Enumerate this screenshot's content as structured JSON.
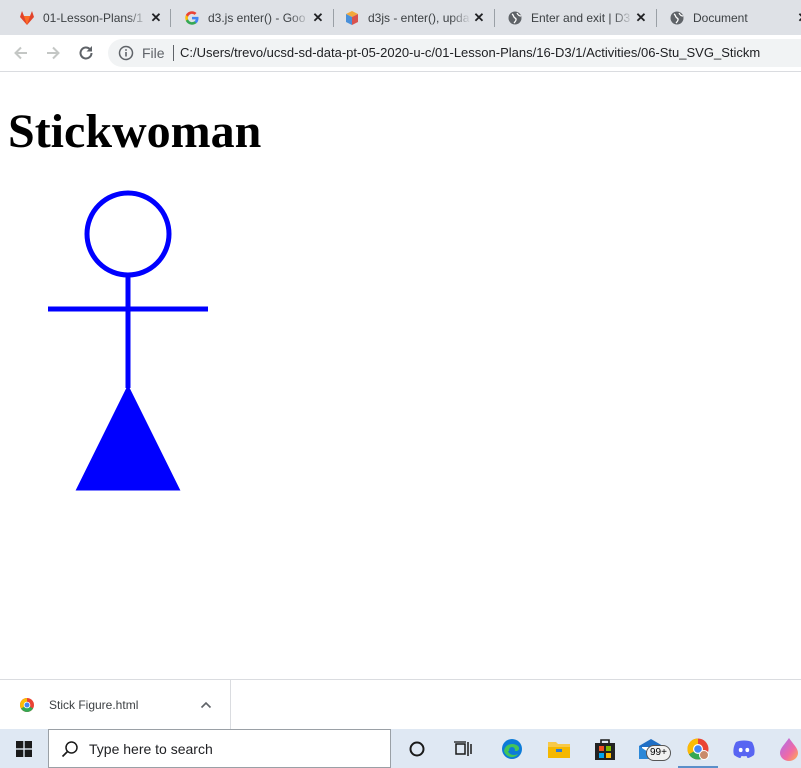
{
  "browser": {
    "tabs": [
      {
        "title": "01-Lesson-Plans/1",
        "favicon": "gitlab-icon"
      },
      {
        "title": "d3.js enter() - Goo",
        "favicon": "google-icon"
      },
      {
        "title": "d3js - enter(), upda",
        "favicon": "cube-icon"
      },
      {
        "title": "Enter and exit | D3",
        "favicon": "globe-icon"
      },
      {
        "title": "Document",
        "favicon": "globe-icon"
      }
    ],
    "file_label": "File",
    "url": "C:/Users/trevo/ucsd-sd-data-pt-05-2020-u-c/01-Lesson-Plans/16-D3/1/Activities/06-Stu_SVG_Stickm"
  },
  "page": {
    "heading": "Stickwoman",
    "figure_color": "#0000ff"
  },
  "downloads": {
    "filename": "Stick Figure.html"
  },
  "taskbar": {
    "search_placeholder": "Type here to search",
    "mail_badge": "99+"
  }
}
